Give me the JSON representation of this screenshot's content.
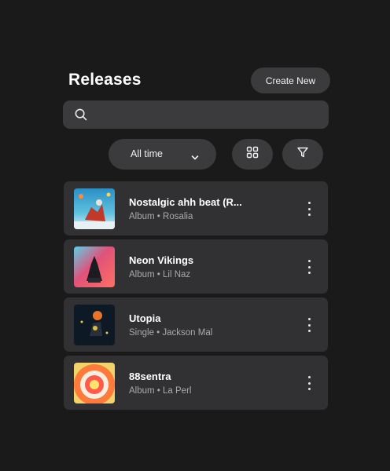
{
  "header": {
    "title": "Releases",
    "create_label": "Create New"
  },
  "search": {
    "icon": "search-icon",
    "placeholder": ""
  },
  "filters": {
    "time_range": "All time",
    "grid_view_icon": "grid-icon",
    "filter_icon": "funnel-icon"
  },
  "releases": [
    {
      "title": "Nostalgic ahh beat (R...",
      "type": "Album",
      "artist": "Rosalia",
      "sub": "Album • Rosalia"
    },
    {
      "title": "Neon Vikings",
      "type": "Album",
      "artist": "Lil Naz",
      "sub": "Album • Lil Naz"
    },
    {
      "title": "Utopia",
      "type": "Single",
      "artist": "Jackson Mal",
      "sub": "Single • Jackson Mal"
    },
    {
      "title": "88sentra",
      "type": "Album",
      "artist": "La Perl",
      "sub": "Album • La Perl"
    }
  ],
  "colors": {
    "background": "#1a1a1b",
    "surface": "#3b3b3d",
    "row": "#313133",
    "secondary_text": "#a9a9ab"
  }
}
